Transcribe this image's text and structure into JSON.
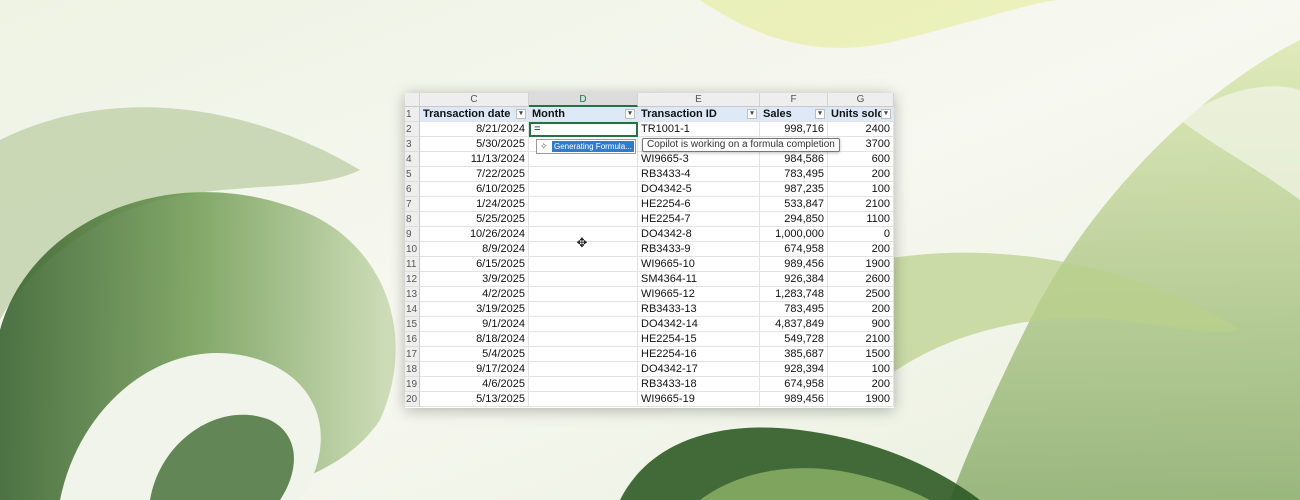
{
  "spreadsheet": {
    "column_letters": [
      "C",
      "D",
      "E",
      "F",
      "G"
    ],
    "selected_column": "D",
    "headers": [
      "Transaction date",
      "Month",
      "Transaction ID",
      "Sales",
      "Units sold"
    ],
    "filter_glyph": "▾",
    "active_cell_value": "=",
    "rows": [
      {
        "num": "1",
        "date": "",
        "month": "",
        "id": "",
        "sales": "",
        "units": ""
      },
      {
        "num": "2",
        "date": "8/21/2024",
        "id": "TR1001-1",
        "sales": "998,716",
        "units": "2400"
      },
      {
        "num": "3",
        "date": "5/30/2025",
        "id": "",
        "sales": "",
        "units": "3700"
      },
      {
        "num": "4",
        "date": "11/13/2024",
        "id": "WI9665-3",
        "sales": "984,586",
        "units": "600"
      },
      {
        "num": "5",
        "date": "7/22/2025",
        "id": "RB3433-4",
        "sales": "783,495",
        "units": "200"
      },
      {
        "num": "6",
        "date": "6/10/2025",
        "id": "DO4342-5",
        "sales": "987,235",
        "units": "100"
      },
      {
        "num": "7",
        "date": "1/24/2025",
        "id": "HE2254-6",
        "sales": "533,847",
        "units": "2100"
      },
      {
        "num": "8",
        "date": "5/25/2025",
        "id": "HE2254-7",
        "sales": "294,850",
        "units": "1100"
      },
      {
        "num": "9",
        "date": "10/26/2024",
        "id": "DO4342-8",
        "sales": "1,000,000",
        "units": "0"
      },
      {
        "num": "10",
        "date": "8/9/2024",
        "id": "RB3433-9",
        "sales": "674,958",
        "units": "200"
      },
      {
        "num": "11",
        "date": "6/15/2025",
        "id": "WI9665-10",
        "sales": "989,456",
        "units": "1900"
      },
      {
        "num": "12",
        "date": "3/9/2025",
        "id": "SM4364-11",
        "sales": "926,384",
        "units": "2600"
      },
      {
        "num": "13",
        "date": "4/2/2025",
        "id": "WI9665-12",
        "sales": "1,283,748",
        "units": "2500"
      },
      {
        "num": "14",
        "date": "3/19/2025",
        "id": "RB3433-13",
        "sales": "783,495",
        "units": "200"
      },
      {
        "num": "15",
        "date": "9/1/2024",
        "id": "DO4342-14",
        "sales": "4,837,849",
        "units": "900"
      },
      {
        "num": "16",
        "date": "8/18/2024",
        "id": "HE2254-15",
        "sales": "549,728",
        "units": "2100"
      },
      {
        "num": "17",
        "date": "5/4/2025",
        "id": "HE2254-16",
        "sales": "385,687",
        "units": "1500"
      },
      {
        "num": "18",
        "date": "9/17/2024",
        "id": "DO4342-17",
        "sales": "928,394",
        "units": "100"
      },
      {
        "num": "19",
        "date": "4/6/2025",
        "id": "RB3433-18",
        "sales": "674,958",
        "units": "200"
      },
      {
        "num": "20",
        "date": "5/13/2025",
        "id": "WI9665-19",
        "sales": "989,456",
        "units": "1900"
      }
    ]
  },
  "copilot": {
    "generating_label": "Generating Formula...",
    "generating_icon": "sparkle-icon",
    "tooltip": "Copilot is working on a formula completion"
  },
  "pointer": {
    "icon": "move-cursor-icon",
    "glyph": "✥"
  },
  "colors": {
    "excel_green": "#217346",
    "header_fill": "#dde9f6",
    "copilot_blue": "#2e7cd0"
  }
}
